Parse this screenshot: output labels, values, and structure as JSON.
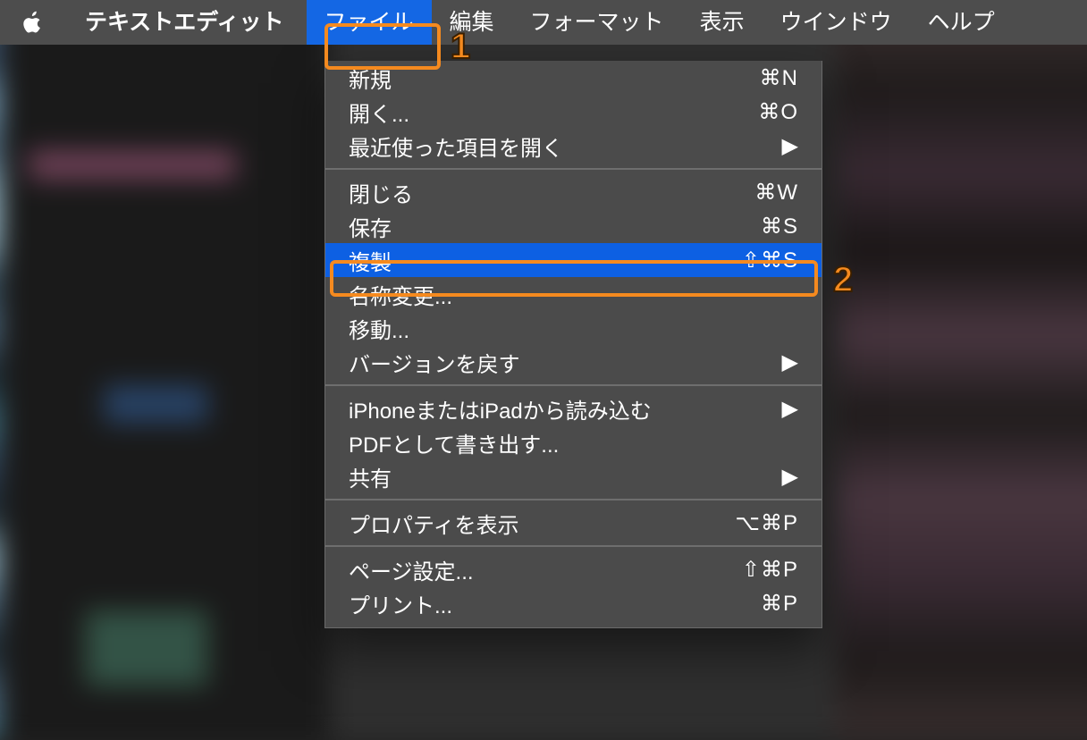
{
  "menubar": {
    "appname": "テキストエディット",
    "items": [
      "ファイル",
      "編集",
      "フォーマット",
      "表示",
      "ウインドウ",
      "ヘルプ"
    ],
    "selected_index": 0
  },
  "dropdown": {
    "groups": [
      [
        {
          "label": "新規",
          "shortcut": "⌘N"
        },
        {
          "label": "開く...",
          "shortcut": "⌘O"
        },
        {
          "label": "最近使った項目を開く",
          "submenu": true
        }
      ],
      [
        {
          "label": "閉じる",
          "shortcut": "⌘W"
        },
        {
          "label": "保存",
          "shortcut": "⌘S"
        },
        {
          "label": "複製",
          "shortcut": "⇧⌘S",
          "selected": true
        },
        {
          "label": "名称変更..."
        },
        {
          "label": "移動..."
        },
        {
          "label": "バージョンを戻す",
          "submenu": true
        }
      ],
      [
        {
          "label": "iPhoneまたはiPadから読み込む",
          "submenu": true
        },
        {
          "label": "PDFとして書き出す..."
        },
        {
          "label": "共有",
          "submenu": true
        }
      ],
      [
        {
          "label": "プロパティを表示",
          "shortcut": "⌥⌘P"
        }
      ],
      [
        {
          "label": "ページ設定...",
          "shortcut": "⇧⌘P"
        },
        {
          "label": "プリント...",
          "shortcut": "⌘P"
        }
      ]
    ]
  },
  "annotations": {
    "1": "1",
    "2": "2"
  }
}
